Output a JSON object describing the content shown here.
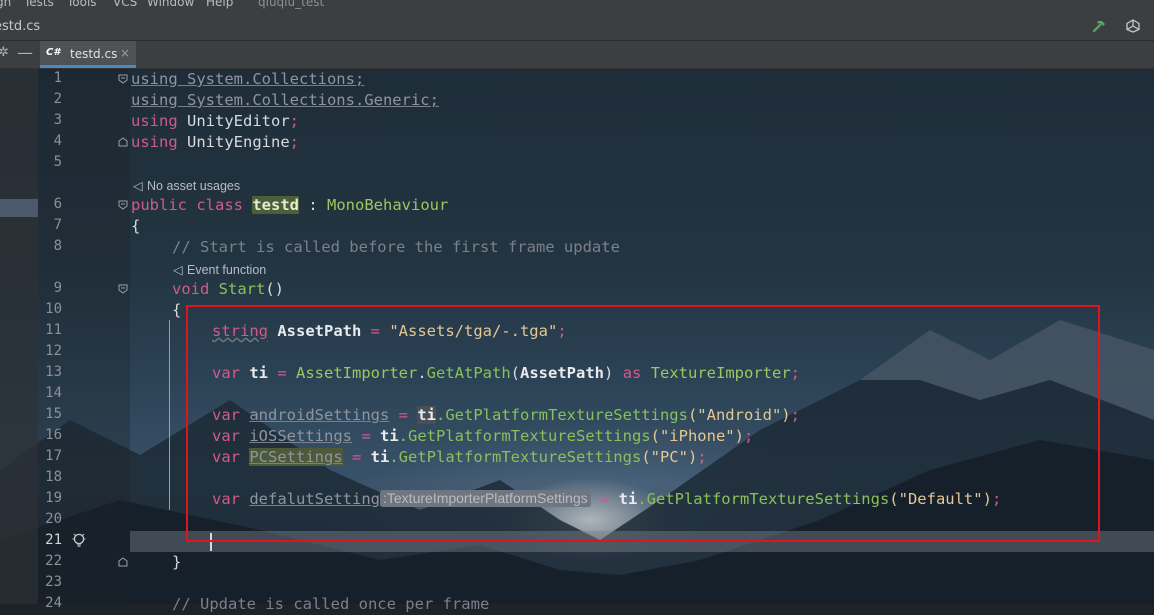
{
  "menu": {
    "items": [
      "gn",
      "Tests",
      "Tools",
      "VCS",
      "Window",
      "Help"
    ],
    "project": "qiuqiu_test"
  },
  "nav": {
    "breadcrumb": "estd.cs"
  },
  "toolbar": {
    "ctrl_settings": "✲",
    "ctrl_hide": "—"
  },
  "tab": {
    "lang_badge": "C#",
    "name": "testd.cs",
    "close": "×"
  },
  "editor": {
    "line_numbers": [
      "1",
      "2",
      "3",
      "4",
      "5",
      "6",
      "7",
      "8",
      "9",
      "10",
      "11",
      "12",
      "13",
      "14",
      "15",
      "16",
      "17",
      "18",
      "19",
      "20",
      "21",
      "22",
      "23",
      "24"
    ],
    "lens_asset_usages": "No asset usages",
    "lens_event_function": "Event function",
    "inlay_hint": ":TextureImporterPlatformSettings",
    "lines": {
      "l1_kw": "using",
      "l1_ns": " System.Collections;",
      "l2_kw": "using",
      "l2_ns": " System.Collections.Generic;",
      "l3_kw": "using",
      "l3_ns": " UnityEditor",
      "l4_kw": "using",
      "l4_ns": " UnityEngine",
      "l6_public": "public",
      "l6_class": " class ",
      "l6_name": "testd",
      "l6_colon": " : ",
      "l6_base": "MonoBehaviour",
      "l7_brace": "{",
      "l8_comment": "// Start is called before the first frame update",
      "l9_void": "void ",
      "l9_name": "Start",
      "l9_parens": "()",
      "l10_brace": "{",
      "l11_type": "string",
      "l11_var": " AssetPath",
      "l11_eq": " = ",
      "l11_str": "\"Assets/tga/-.tga\"",
      "l13_var_kw": "var",
      "l13_name": " ti",
      "l13_eq": " = ",
      "l13_type": "AssetImporter",
      "l13_dot": ".",
      "l13_fn": "GetAtPath",
      "l13_open": "(",
      "l13_arg": "AssetPath",
      "l13_close": ")",
      "l13_as": " as ",
      "l13_type2": "TextureImporter",
      "l15_var_kw": "var",
      "l15_name": "androidSettings",
      "l15_eq": " = ",
      "l15_ti": "ti",
      "l15_call": ".GetPlatformTextureSettings",
      "l15_arg": "(\"Android\")",
      "l16_var_kw": "var",
      "l16_name": "iOSSettings",
      "l16_eq": " = ",
      "l16_ti": "ti",
      "l16_call": ".GetPlatformTextureSettings",
      "l16_arg": "(\"iPhone\")",
      "l17_var_kw": "var",
      "l17_name": "PCSettings",
      "l17_eq": " = ",
      "l17_ti": "ti",
      "l17_call": ".GetPlatformTextureSettings",
      "l17_arg": "(\"PC\")",
      "l19_var_kw": "var",
      "l19_name": "defalutSetting",
      "l19_eq": " = ",
      "l19_ti": "ti",
      "l19_call": ".GetPlatformTextureSettings",
      "l19_arg": "(\"Default\")",
      "l22_brace": "}",
      "l24_comment": "// Update is called once per frame",
      "semicolon": ";"
    }
  },
  "colors": {
    "keyword": "#d25a8a",
    "type": "#9cc75e",
    "string": "#e4c892",
    "annotation_box": "#e0141b",
    "tab_underline": "#4a88c7"
  }
}
